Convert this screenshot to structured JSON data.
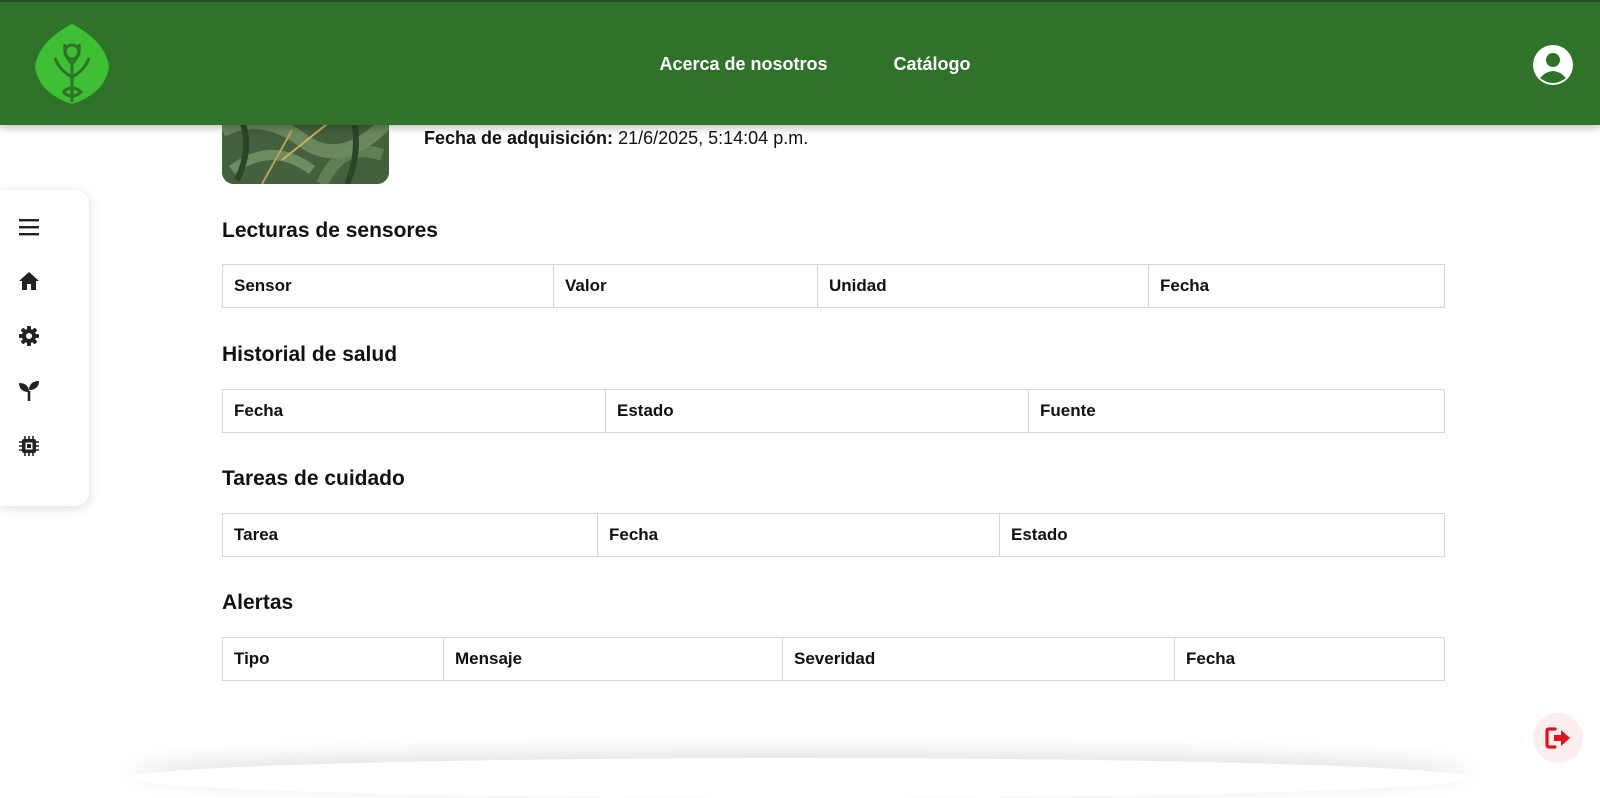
{
  "header": {
    "nav": [
      {
        "label": "Acerca de nosotros"
      },
      {
        "label": "Catálogo"
      }
    ],
    "brand_color": "#2f722a"
  },
  "plant": {
    "acquisition_label": "Fecha de adquisición:",
    "acquisition_value": "21/6/2025, 5:14:04 p.m."
  },
  "sidebar": {
    "items": [
      {
        "icon": "menu-icon"
      },
      {
        "icon": "home-icon"
      },
      {
        "icon": "gear-icon"
      },
      {
        "icon": "sprout-icon"
      },
      {
        "icon": "chip-icon"
      }
    ]
  },
  "sections": {
    "sensores": {
      "title": "Lecturas de sensores",
      "columns": [
        "Sensor",
        "Valor",
        "Unidad",
        "Fecha"
      ]
    },
    "salud": {
      "title": "Historial de salud",
      "columns": [
        "Fecha",
        "Estado",
        "Fuente"
      ]
    },
    "tareas": {
      "title": "Tareas de cuidado",
      "columns": [
        "Tarea",
        "Fecha",
        "Estado"
      ]
    },
    "alertas": {
      "title": "Alertas",
      "columns": [
        "Tipo",
        "Mensaje",
        "Severidad",
        "Fecha"
      ]
    }
  },
  "colors": {
    "logout_icon": "#e0151b"
  }
}
